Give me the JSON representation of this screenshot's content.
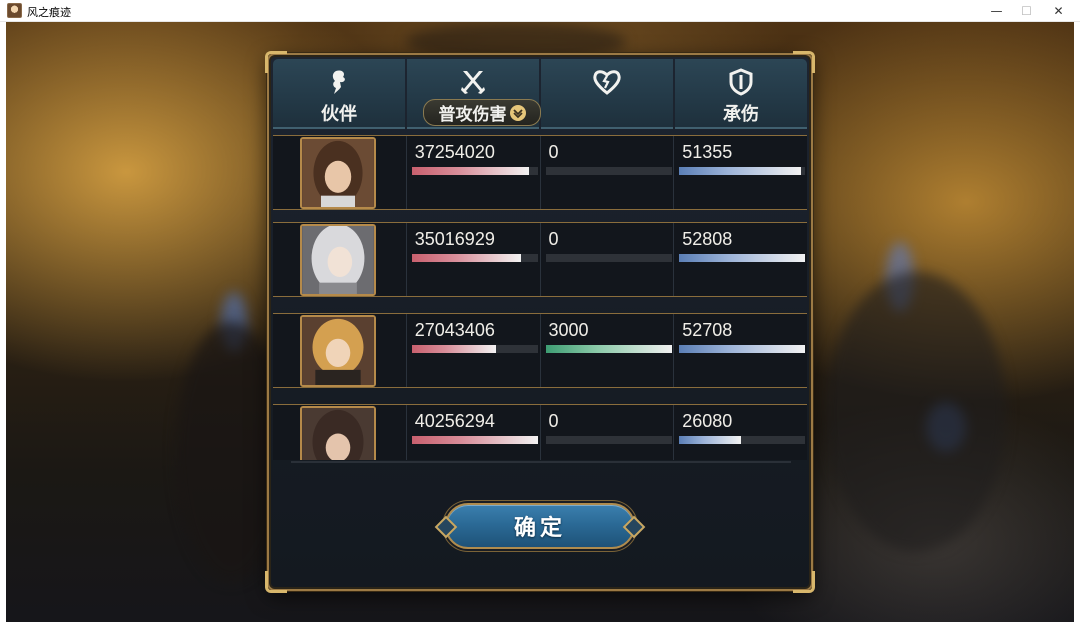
{
  "window": {
    "title": "风之痕迹",
    "minimize": "—",
    "maximize": "☐",
    "close": "✕"
  },
  "header": {
    "columns": [
      {
        "icon": "stylized-figure-icon",
        "label": "伙伴"
      },
      {
        "icon": "crossed-swords-icon",
        "label": "普攻伤害",
        "dropdown": true
      },
      {
        "icon": "broken-heart-icon",
        "label": ""
      },
      {
        "icon": "shield-icon",
        "label": "承伤"
      }
    ]
  },
  "rows": [
    {
      "portrait": "brown-hair-girl-portrait",
      "damage": "37254020",
      "damage_pct": 0.93,
      "heal": "0",
      "heal_pct": 0,
      "taken": "51355",
      "taken_pct": 0.97
    },
    {
      "portrait": "white-hair-girl-portrait",
      "damage": "35016929",
      "damage_pct": 0.87,
      "heal": "0",
      "heal_pct": 0,
      "taken": "52808",
      "taken_pct": 1.0
    },
    {
      "portrait": "blonde-girl-portrait",
      "damage": "27043406",
      "damage_pct": 0.67,
      "heal": "3000",
      "heal_pct": 1.0,
      "taken": "52708",
      "taken_pct": 1.0
    },
    {
      "portrait": "dark-hair-girl-portrait",
      "damage": "40256294",
      "damage_pct": 1.0,
      "heal": "0",
      "heal_pct": 0,
      "taken": "26080",
      "taken_pct": 0.49
    }
  ],
  "confirm_label": "确定",
  "colors": {
    "panel_border": "#9c7a45",
    "header_bg": "#2c4655",
    "damage_bar": "#c8606e",
    "heal_bar": "#3e9d73",
    "taken_bar": "#5b7fb6",
    "confirm_bg": "#2b6a96"
  }
}
